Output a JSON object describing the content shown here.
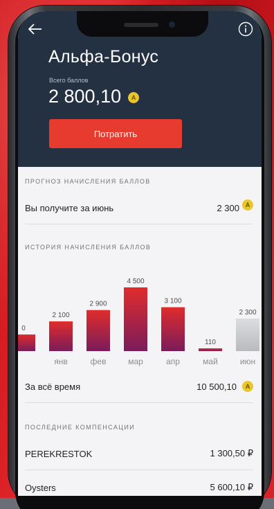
{
  "header": {
    "title": "Альфа-Бонус",
    "total_label": "Всего баллов",
    "total_value": "2 800,10",
    "coin_symbol": "А",
    "spend_button": "Потратить"
  },
  "forecast": {
    "section_title": "ПРОГНОЗ НАЧИСЛЕНИЯ БАЛЛОВ",
    "label": "Вы получите за июнь",
    "value": "2 300"
  },
  "history": {
    "section_title": "ИСТОРИЯ НАЧИСЛЕНИЯ БАЛЛОВ",
    "all_time_label": "За всё время",
    "all_time_value": "10 500,10"
  },
  "chart_data": {
    "type": "bar",
    "categories": [
      "",
      "янв",
      "фев",
      "мар",
      "апр",
      "май",
      "июн"
    ],
    "values": [
      0,
      2100,
      2900,
      4500,
      3100,
      110,
      2300
    ],
    "value_labels": [
      "0",
      "2 100",
      "2 900",
      "4 500",
      "3 100",
      "110",
      "2 300"
    ],
    "forecast_index": 6,
    "ylim": [
      0,
      4500
    ],
    "colors": {
      "bar_top": "#e02c2c",
      "bar_bottom": "#7a1c5a",
      "forecast": "#c8c9cc"
    }
  },
  "compensations": {
    "section_title": "ПОСЛЕДНИЕ КОМПЕНСАЦИИ",
    "items": [
      {
        "name": "PEREKRESTOK",
        "amount": "1 300,50 ₽"
      },
      {
        "name": "Oysters",
        "amount": "5 600,10 ₽"
      }
    ]
  },
  "colors": {
    "header_bg": "#233142",
    "accent": "#e63b2e",
    "coin": "#e9c62a"
  }
}
